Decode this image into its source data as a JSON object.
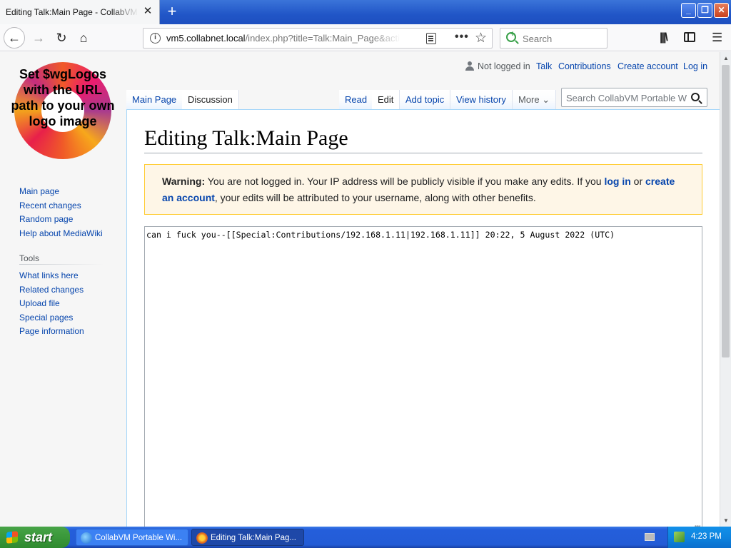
{
  "browser": {
    "tab_title": "Editing Talk:Main Page - CollabVM Portable Wiki - Mozilla Firefox",
    "tab_close": "✕",
    "new_tab": "+",
    "window_controls": {
      "minimize": "_",
      "maximize": "❐",
      "close": "✕"
    },
    "url_host": "vm5.collabnet.local",
    "url_path": "/index.php?title=Talk:Main_Page&action=edit",
    "search_placeholder": "Search",
    "icons": [
      "back-arrow-icon",
      "forward-arrow-icon",
      "reload-icon",
      "home-icon",
      "site-info-icon",
      "reader-view-icon",
      "page-actions-icon",
      "bookmark-star-icon",
      "library-icon",
      "sidebar-icon",
      "hamburger-menu-icon"
    ]
  },
  "wiki": {
    "logo_text": "Set $wgLogos with the URL path to your own logo image",
    "personal": {
      "not_logged_in": "Not logged in",
      "talk": "Talk",
      "contributions": "Contributions",
      "create_account": "Create account",
      "log_in": "Log in"
    },
    "namespaces": {
      "main_page": "Main Page",
      "discussion": "Discussion"
    },
    "views": {
      "read": "Read",
      "edit": "Edit",
      "add_topic": "Add topic",
      "view_history": "View history",
      "more": "More"
    },
    "search_placeholder": "Search CollabVM Portable Wiki",
    "navigation": [
      "Main page",
      "Recent changes",
      "Random page",
      "Help about MediaWiki"
    ],
    "tools_heading": "Tools",
    "tools": [
      "What links here",
      "Related changes",
      "Upload file",
      "Special pages",
      "Page information"
    ],
    "heading": "Editing Talk:Main Page",
    "warning": {
      "label": "Warning:",
      "text1": " You are not logged in. Your IP address will be publicly visible if you make any edits. If you ",
      "login_link": "log in",
      "text2": " or ",
      "create_link": "create an account",
      "text3": ", your edits will be attributed to your username, along with other benefits."
    },
    "editor_content": "can i fuck you--[[Special:Contributions/192.168.1.11|192.168.1.11]] 20:22, 5 August 2022 (UTC)"
  },
  "taskbar": {
    "start_label": "start",
    "tasks": [
      "CollabVM Portable Wi...",
      "Editing Talk:Main Pag..."
    ],
    "clock": "4:23 PM"
  },
  "colors": {
    "link": "#0645ad",
    "warning_bg": "#fef6e7",
    "warning_border": "#ffcc33",
    "xp_blue": "#245edb",
    "start_green": "#3c9a3c"
  }
}
